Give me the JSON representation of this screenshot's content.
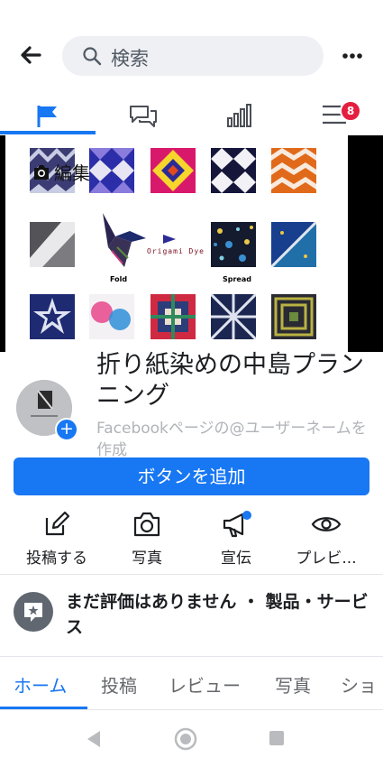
{
  "search": {
    "placeholder": "検索"
  },
  "nav": {
    "notification_count": "8"
  },
  "cover": {
    "edit_label": "編集",
    "brand_text": "Origami Dye",
    "fold_label": "Fold",
    "spread_label": "Spread"
  },
  "page": {
    "name": "折り紙染めの中島プランニング",
    "username_prompt": "Facebookページの@ユーザーネームを作成"
  },
  "primary_button": {
    "label": "ボタンを追加"
  },
  "actions": [
    {
      "label": "投稿する"
    },
    {
      "label": "写真"
    },
    {
      "label": "宣伝"
    },
    {
      "label": "プレビ..."
    }
  ],
  "rating": {
    "text": "まだ評価はありません ・ 製品・サービス"
  },
  "tabs": [
    {
      "label": "ホーム"
    },
    {
      "label": "投稿"
    },
    {
      "label": "レビュー"
    },
    {
      "label": "写真"
    },
    {
      "label": "ショ"
    }
  ],
  "colors": {
    "accent": "#1877f2",
    "badge": "#e41e3f"
  }
}
